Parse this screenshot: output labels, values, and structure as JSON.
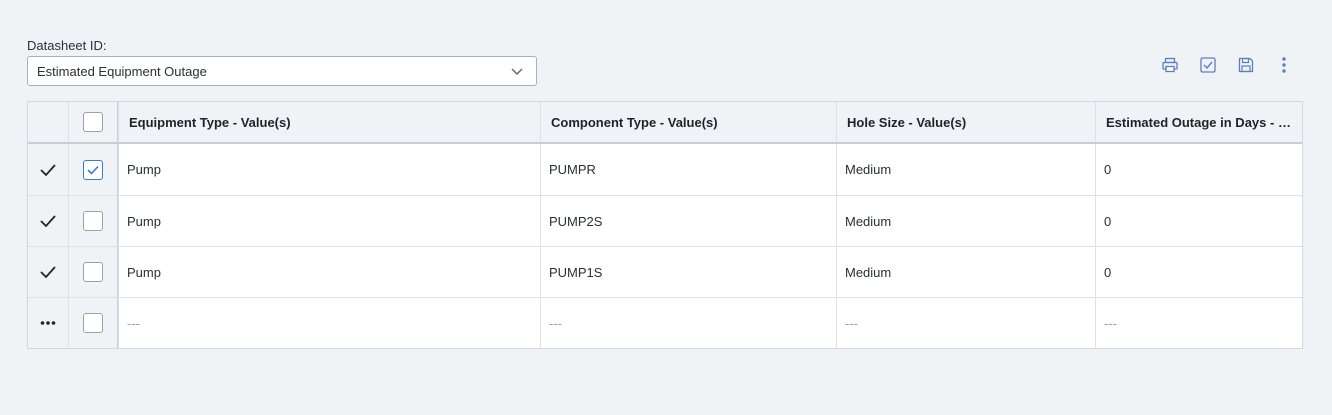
{
  "datasheet": {
    "label": "Datasheet ID:",
    "selected": "Estimated Equipment Outage"
  },
  "toolbar": {
    "icons": [
      "print-icon",
      "validate-icon",
      "save-icon",
      "more-icon"
    ]
  },
  "colors": {
    "accent": "#3b7bd4",
    "icon": "#5a7fc0"
  },
  "grid": {
    "columns": [
      "Equipment Type - Value(s)",
      "Component Type - Value(s)",
      "Hole Size - Value(s)",
      "Estimated Outage in Days - Va..."
    ],
    "rows": [
      {
        "equipment": "Pump",
        "component": "PUMPR",
        "hole": "Medium",
        "outage": "0"
      },
      {
        "equipment": "Pump",
        "component": "PUMP2S",
        "hole": "Medium",
        "outage": "0"
      },
      {
        "equipment": "Pump",
        "component": "PUMP1S",
        "hole": "Medium",
        "outage": "0"
      },
      {
        "equipment": "---",
        "component": "---",
        "hole": "---",
        "outage": "---"
      }
    ]
  }
}
